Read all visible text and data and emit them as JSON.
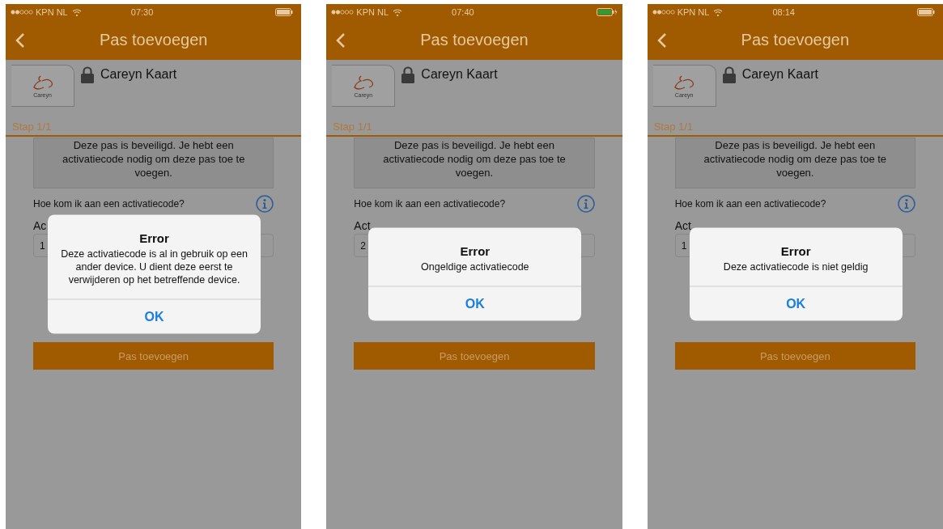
{
  "screens": [
    {
      "status_bar": {
        "carrier": "KPN NL",
        "time": "07:30",
        "charging": false
      },
      "nav": {
        "title": "Pas toevoegen"
      },
      "card": {
        "logo_text": "Careyn",
        "name": "Careyn Kaart"
      },
      "step": "Stap 1/1",
      "notice": "Deze pas is beveiligd. Je hebt een activatiecode nodig om deze pas toe te voegen.",
      "help_question": "Hoe kom ik aan een activatiecode?",
      "code_label": "Ac",
      "code_value": "1",
      "submit_button": "Pas toevoegen",
      "alert": {
        "title": "Error",
        "message": "Deze activatiecode is al in gebruik op een ander device. U dient deze eerst te verwijderen op het betreffende device.",
        "button": "OK"
      }
    },
    {
      "status_bar": {
        "carrier": "KPN NL",
        "time": "07:40",
        "charging": true
      },
      "nav": {
        "title": "Pas toevoegen"
      },
      "card": {
        "logo_text": "Careyn",
        "name": "Careyn Kaart"
      },
      "step": "Stap 1/1",
      "notice": "Deze pas is beveiligd. Je hebt een activatiecode nodig om deze pas toe te voegen.",
      "help_question": "Hoe kom ik aan een activatiecode?",
      "code_label": "Act",
      "code_value": "2",
      "submit_button": "Pas toevoegen",
      "alert": {
        "title": "Error",
        "message": "Ongeldige activatiecode",
        "button": "OK"
      }
    },
    {
      "status_bar": {
        "carrier": "KPN NL",
        "time": "08:14",
        "charging": false
      },
      "nav": {
        "title": "Pas toevoegen"
      },
      "card": {
        "logo_text": "Careyn",
        "name": "Careyn Kaart"
      },
      "step": "Stap 1/1",
      "notice": "Deze pas is beveiligd. Je hebt een activatiecode nodig om deze pas toe te voegen.",
      "help_question": "Hoe kom ik aan een activatiecode?",
      "code_label": "Act",
      "code_value": "1",
      "submit_button": "Pas toevoegen",
      "alert": {
        "title": "Error",
        "message": "Deze activatiecode is niet geldig",
        "button": "OK"
      }
    }
  ]
}
